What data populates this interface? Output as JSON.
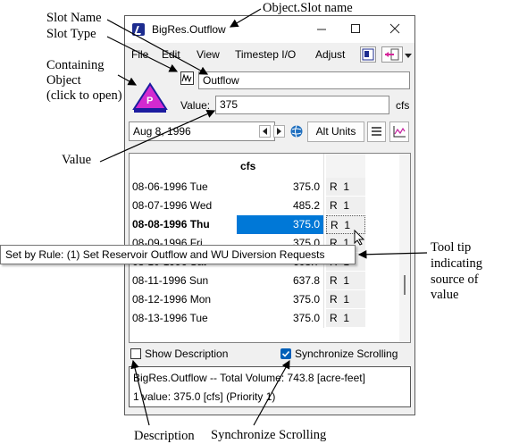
{
  "annotations": {
    "object_slot_name": "Object.Slot name",
    "slot_name": "Slot Name",
    "slot_type": "Slot Type",
    "containing_object_1": "Containing",
    "containing_object_2": "Object",
    "containing_object_3": "(click to open)",
    "value": "Value",
    "tooltip_label_1": "Tool tip",
    "tooltip_label_2": "indicating",
    "tooltip_label_3": "source of",
    "tooltip_label_4": "value",
    "description": "Description",
    "synchronize_scrolling": "Synchronize Scrolling"
  },
  "window": {
    "title": "BigRes.Outflow",
    "minimize_icon": "minimize-icon",
    "maximize_icon": "maximize-icon",
    "close_icon": "close-icon"
  },
  "menu": {
    "file": "File",
    "edit": "Edit",
    "view": "View",
    "timestep_io": "Timestep I/O",
    "adjust": "Adjust"
  },
  "slot": {
    "object_icon_letter": "P",
    "name": "Outflow",
    "value_label": "Value:",
    "value": "375",
    "units": "cfs",
    "date": "Aug 8, 1996",
    "alt_units": "Alt Units"
  },
  "table": {
    "column_header": "cfs",
    "rows": [
      {
        "date": "08-06-1996 Tue",
        "value": "375.0",
        "flag": "R",
        "priority": "1"
      },
      {
        "date": "08-07-1996 Wed",
        "value": "485.2",
        "flag": "R",
        "priority": "1"
      },
      {
        "date": "08-08-1996 Thu",
        "value": "375.0",
        "flag": "R",
        "priority": "1",
        "selected": true
      },
      {
        "date": "08-09-1996 Fri",
        "value": "375.0",
        "flag": "R",
        "priority": "1"
      },
      {
        "date": "08-10-1996 Sat",
        "value": "608.7",
        "flag": "R",
        "priority": "1"
      },
      {
        "date": "08-11-1996 Sun",
        "value": "637.8",
        "flag": "R",
        "priority": "1"
      },
      {
        "date": "08-12-1996 Mon",
        "value": "375.0",
        "flag": "R",
        "priority": "1"
      },
      {
        "date": "08-13-1996 Tue",
        "value": "375.0",
        "flag": "R",
        "priority": "1"
      }
    ]
  },
  "tooltip": "Set by Rule: (1) Set Reservoir Outflow and WU Diversion Requests",
  "options": {
    "show_description": "Show Description",
    "show_description_checked": false,
    "synchronize_scrolling": "Synchronize Scrolling",
    "synchronize_scrolling_checked": true
  },
  "status": {
    "line1": "BigRes.Outflow -- Total Volume: 743.8 [acre-feet]",
    "line2": "1 value:  375.0 [cfs]  (Priority 1)"
  },
  "colors": {
    "selection": "#0078d7",
    "checkbox_checked": "#005fb8",
    "object_icon_fill": "#d32ad0",
    "object_icon_border": "#1c1ca0"
  }
}
